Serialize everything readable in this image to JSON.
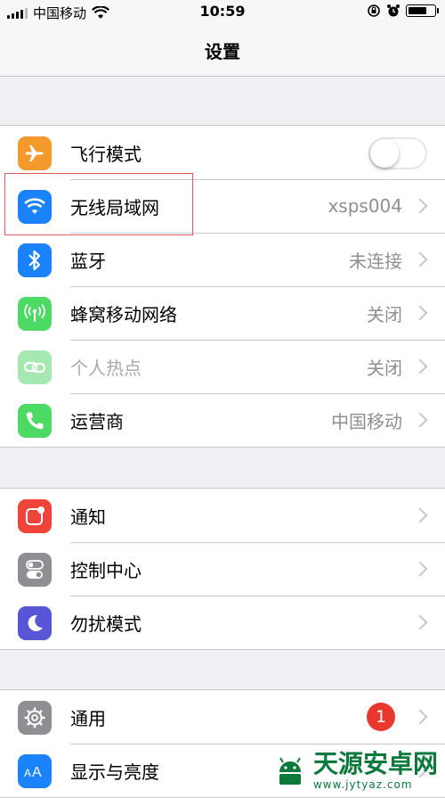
{
  "status_bar": {
    "carrier": "中国移动",
    "time": "10:59",
    "battery_level": 0.75,
    "icons": [
      "signal-icon",
      "wifi-icon",
      "orientation-lock-icon",
      "alarm-icon",
      "battery-icon"
    ]
  },
  "nav": {
    "title": "设置"
  },
  "groups": {
    "connectivity": [
      {
        "label": "飞行模式",
        "icon": "airplane-icon",
        "icon_color": "#f49a2c",
        "control": "toggle",
        "toggle_on": false
      },
      {
        "label": "无线局域网",
        "icon": "wifi-icon",
        "icon_color": "#1a82fb",
        "value": "xsps004"
      },
      {
        "label": "蓝牙",
        "icon": "bluetooth-icon",
        "icon_color": "#1a82fb",
        "value": "未连接"
      },
      {
        "label": "蜂窝移动网络",
        "icon": "cellular-icon",
        "icon_color": "#4cd964",
        "value": "关闭"
      },
      {
        "label": "个人热点",
        "icon": "hotspot-icon",
        "icon_color": "#a6e8b2",
        "value": "关闭",
        "disabled": true
      },
      {
        "label": "运营商",
        "icon": "phone-icon",
        "icon_color": "#4cd964",
        "value": "中国移动"
      }
    ],
    "notifications": [
      {
        "label": "通知",
        "icon": "notifications-icon",
        "icon_color": "#f0433a"
      },
      {
        "label": "控制中心",
        "icon": "control-center-icon",
        "icon_color": "#8e8e93"
      },
      {
        "label": "勿扰模式",
        "icon": "moon-icon",
        "icon_color": "#5856d6"
      }
    ],
    "general": [
      {
        "label": "通用",
        "icon": "gear-icon",
        "icon_color": "#8e8e93",
        "badge": "1"
      },
      {
        "label": "显示与亮度",
        "icon": "display-icon",
        "icon_color": "#1a82fb"
      }
    ]
  },
  "watermark": {
    "title": "天源安卓网",
    "url": "www.jytyaz.com"
  }
}
